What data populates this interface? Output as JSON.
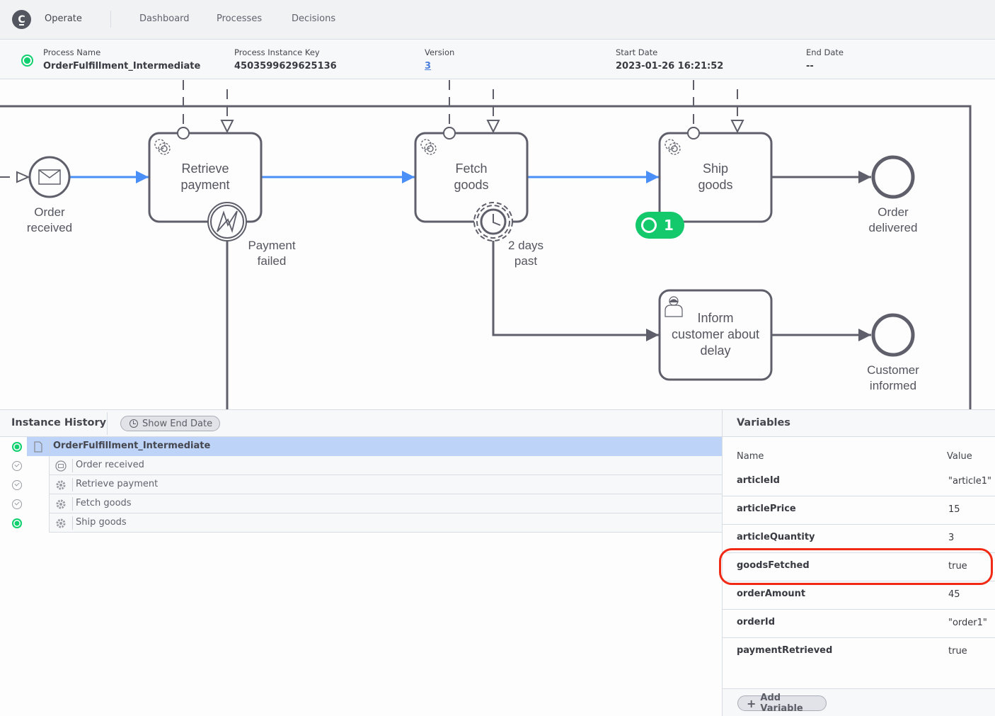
{
  "app": {
    "logo_letter": "C",
    "name": "Operate",
    "nav": [
      "Dashboard",
      "Processes",
      "Decisions"
    ]
  },
  "instance": {
    "state": "active",
    "fields": [
      {
        "label": "Process Name",
        "value": "OrderFulfillment_Intermediate"
      },
      {
        "label": "Process Instance Key",
        "value": "4503599629625136"
      },
      {
        "label": "Version",
        "value": "3"
      },
      {
        "label": "Start Date",
        "value": "2023-01-26 16:21:52"
      },
      {
        "label": "End Date",
        "value": "--"
      }
    ]
  },
  "diagram": {
    "flow_color_active": "#4a8ff7",
    "flow_color_default": "#5f5f6b",
    "events": [
      {
        "id": "order-received",
        "type": "message-start-event",
        "label_lines": [
          "Order",
          "received"
        ]
      },
      {
        "id": "order-delivered",
        "type": "end-event",
        "label_lines": [
          "Order",
          "delivered"
        ]
      },
      {
        "id": "customer-informed",
        "type": "end-event",
        "label_lines": [
          "Customer",
          "informed"
        ]
      },
      {
        "id": "payment-failed",
        "type": "error-boundary-event",
        "label_lines": [
          "Payment",
          "failed"
        ]
      },
      {
        "id": "two-days-past",
        "type": "timer-boundary-event",
        "label_lines": [
          "2 days",
          "past"
        ]
      }
    ],
    "tasks": [
      {
        "id": "retrieve-payment",
        "type": "service-task",
        "label_lines": [
          "Retrieve",
          "payment"
        ]
      },
      {
        "id": "fetch-goods",
        "type": "service-task",
        "label_lines": [
          "Fetch",
          "goods"
        ]
      },
      {
        "id": "ship-goods",
        "type": "service-task",
        "label_lines": [
          "Ship",
          "goods"
        ]
      },
      {
        "id": "inform-customer",
        "type": "user-task",
        "label_lines": [
          "Inform",
          "customer about",
          "delay"
        ]
      }
    ],
    "active_token": {
      "task": "ship-goods",
      "count": "1",
      "color": "#14c86c"
    }
  },
  "history": {
    "title": "Instance History",
    "show_end_date_label": "Show End Date",
    "rows": [
      {
        "name": "OrderFulfillment_Intermediate",
        "status": "active",
        "icon": "document-icon",
        "level": "root"
      },
      {
        "name": "Order received",
        "status": "completed",
        "icon": "message-event-icon",
        "level": "child"
      },
      {
        "name": "Retrieve payment",
        "status": "completed",
        "icon": "gear-icon",
        "level": "child"
      },
      {
        "name": "Fetch goods",
        "status": "completed",
        "icon": "gear-icon",
        "level": "child"
      },
      {
        "name": "Ship goods",
        "status": "active",
        "icon": "gear-icon",
        "level": "child"
      }
    ]
  },
  "variables": {
    "title": "Variables",
    "col_name": "Name",
    "col_value": "Value",
    "rows": [
      {
        "name": "articleId",
        "value": "\"article1\""
      },
      {
        "name": "articlePrice",
        "value": "15"
      },
      {
        "name": "articleQuantity",
        "value": "3"
      },
      {
        "name": "goodsFetched",
        "value": "true",
        "highlighted": true
      },
      {
        "name": "orderAmount",
        "value": "45"
      },
      {
        "name": "orderId",
        "value": "\"order1\""
      },
      {
        "name": "paymentRetrieved",
        "value": "true"
      }
    ],
    "add_label": "Add Variable",
    "highlight_color": "#f02a14"
  }
}
